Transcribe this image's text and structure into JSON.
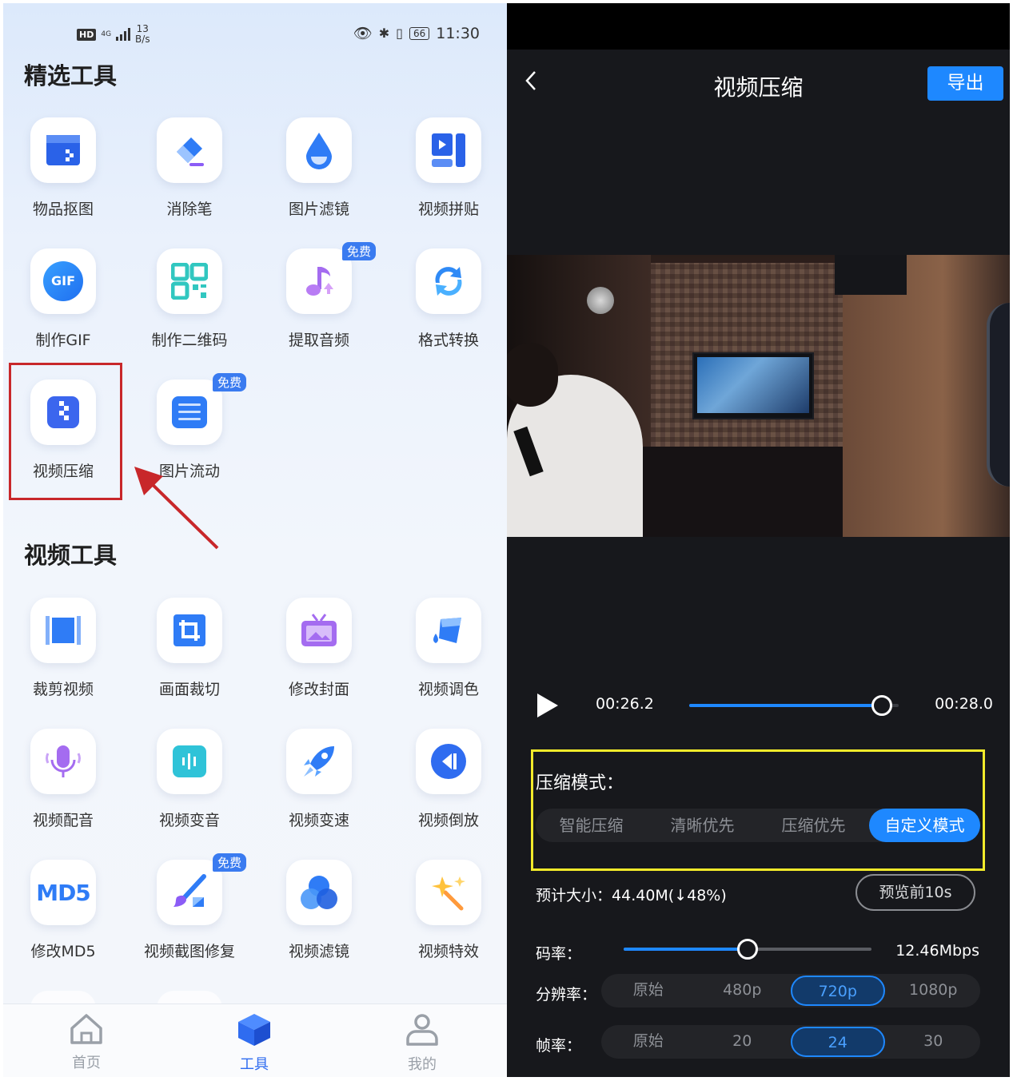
{
  "left": {
    "status": {
      "hd": "HD",
      "network": "4G",
      "speed_value": "13",
      "speed_unit": "B/s",
      "battery": "66",
      "time": "11:30"
    },
    "featured_title": "精选工具",
    "featured_tools": [
      {
        "label": "物品抠图",
        "icon": "image-cutout-icon",
        "badge": ""
      },
      {
        "label": "消除笔",
        "icon": "eraser-icon",
        "badge": ""
      },
      {
        "label": "图片滤镜",
        "icon": "filter-drop-icon",
        "badge": ""
      },
      {
        "label": "视频拼贴",
        "icon": "collage-icon",
        "badge": ""
      },
      {
        "label": "制作GIF",
        "icon": "gif-icon",
        "badge": "",
        "icon_text": "GIF"
      },
      {
        "label": "制作二维码",
        "icon": "qr-code-icon",
        "badge": ""
      },
      {
        "label": "提取音频",
        "icon": "music-note-icon",
        "badge": "免费"
      },
      {
        "label": "格式转换",
        "icon": "convert-icon",
        "badge": ""
      },
      {
        "label": "视频压缩",
        "icon": "compress-icon",
        "badge": ""
      },
      {
        "label": "图片流动",
        "icon": "image-flow-icon",
        "badge": "免费"
      }
    ],
    "video_title": "视频工具",
    "video_tools": [
      {
        "label": "裁剪视频",
        "icon": "trim-video-icon",
        "badge": ""
      },
      {
        "label": "画面裁切",
        "icon": "crop-icon",
        "badge": ""
      },
      {
        "label": "修改封面",
        "icon": "tv-cover-icon",
        "badge": ""
      },
      {
        "label": "视频调色",
        "icon": "paint-bucket-icon",
        "badge": ""
      },
      {
        "label": "视频配音",
        "icon": "microphone-icon",
        "badge": ""
      },
      {
        "label": "视频变音",
        "icon": "voice-change-icon",
        "badge": ""
      },
      {
        "label": "视频变速",
        "icon": "rocket-icon",
        "badge": ""
      },
      {
        "label": "视频倒放",
        "icon": "rewind-icon",
        "badge": ""
      },
      {
        "label": "修改MD5",
        "icon": "md5-icon",
        "badge": "",
        "icon_text": "MD5"
      },
      {
        "label": "视频截图修复",
        "icon": "brush-repair-icon",
        "badge": "免费"
      },
      {
        "label": "视频滤镜",
        "icon": "color-circles-icon",
        "badge": ""
      },
      {
        "label": "视频特效",
        "icon": "sparkle-wand-icon",
        "badge": ""
      }
    ],
    "tabs": [
      {
        "label": "首页",
        "icon": "home-icon"
      },
      {
        "label": "工具",
        "icon": "cube-icon"
      },
      {
        "label": "我的",
        "icon": "user-icon"
      }
    ],
    "active_tab": "工具"
  },
  "right": {
    "title": "视频压缩",
    "export_label": "导出",
    "current_time": "00:26.2",
    "total_time": "00:28.0",
    "playback_progress": 0.92,
    "mode_title": "压缩模式：",
    "modes": [
      "智能压缩",
      "清晰优先",
      "压缩优先",
      "自定义模式"
    ],
    "active_mode": "自定义模式",
    "estimate_label": "预计大小：",
    "estimate_value": "44.40M(↓48%)",
    "preview_label": "预览前10s",
    "bitrate_label": "码率：",
    "bitrate_value": "12.46Mbps",
    "bitrate_level": 0.5,
    "resolution_label": "分辨率：",
    "resolutions": [
      "原始",
      "480p",
      "720p",
      "1080p"
    ],
    "active_resolution": "720p",
    "framerate_label": "帧率：",
    "framerates": [
      "原始",
      "20",
      "24",
      "30"
    ],
    "active_framerate": "24"
  },
  "colors": {
    "accent": "#1e88ff",
    "highlight_red": "#c8272a",
    "highlight_yellow": "#f2ea2a",
    "tab_active": "#2f6cf0"
  }
}
